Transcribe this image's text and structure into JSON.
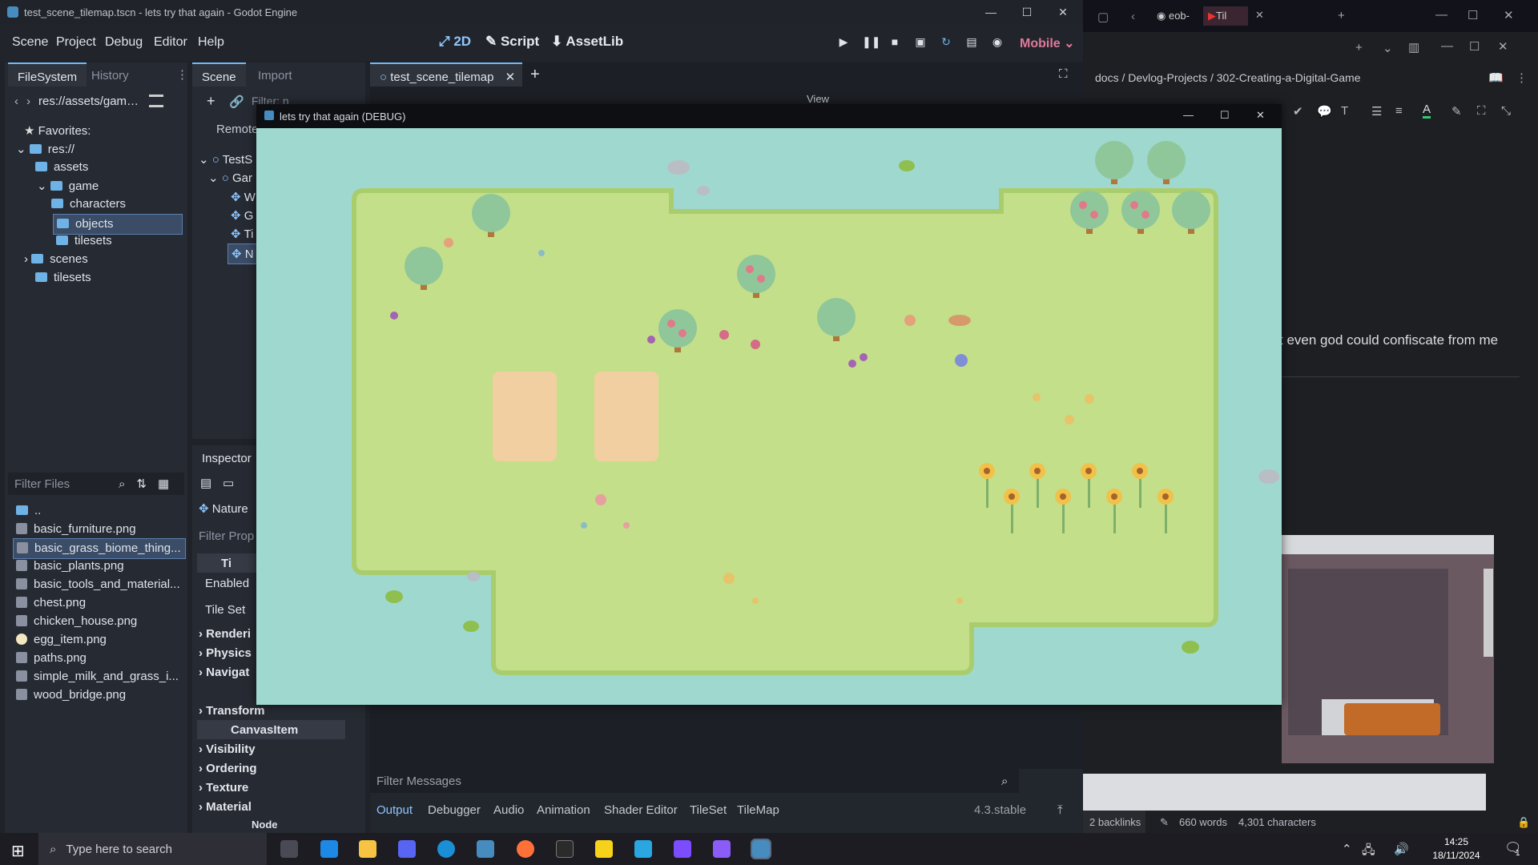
{
  "godot": {
    "window_title": "test_scene_tilemap.tscn - lets try that again - Godot Engine",
    "menu": [
      "Scene",
      "Project",
      "Debug",
      "Editor",
      "Help"
    ],
    "workspaces": [
      "2D",
      "Script",
      "AssetLib"
    ],
    "renderer": "Mobile",
    "filesystem": {
      "tabs": [
        "FileSystem",
        "History"
      ],
      "path": "res://assets/game/o",
      "favorites_label": "Favorites:",
      "tree": [
        "res://",
        "assets",
        "game",
        "characters",
        "objects",
        "tilesets",
        "scenes",
        "tilesets"
      ],
      "filter_placeholder": "Filter Files",
      "files": [
        "..",
        "basic_furniture.png",
        "basic_grass_biome_thing...",
        "basic_plants.png",
        "basic_tools_and_material...",
        "chest.png",
        "chicken_house.png",
        "egg_item.png",
        "paths.png",
        "simple_milk_and_grass_i...",
        "wood_bridge.png"
      ]
    },
    "scene_dock": {
      "tabs": [
        "Scene",
        "Import"
      ],
      "filter_placeholder": "Filter: n",
      "remote_label": "Remote",
      "nodes": [
        "TestS",
        "Gar",
        "W",
        "G",
        "Ti",
        "N"
      ]
    },
    "inspector": {
      "title": "Inspector",
      "node_name": "Nature",
      "filter_placeholder": "Filter Prop",
      "tile_label": "Ti",
      "rows": [
        "Enabled",
        "Tile Set"
      ],
      "sections": [
        "Renderi",
        "Physics",
        "Navigat",
        "Transform",
        "CanvasItem",
        "Visibility",
        "Ordering",
        "Texture",
        "Material"
      ],
      "node_footer": "Node"
    },
    "editor": {
      "tab": "test_scene_tilemap",
      "view_menu": "View",
      "filter_messages_placeholder": "Filter Messages",
      "bottom_tabs": [
        "Output",
        "Debugger",
        "Audio",
        "Animation",
        "Shader Editor",
        "TileSet",
        "TileMap"
      ],
      "version": "4.3.stable"
    }
  },
  "game_window": {
    "title": "lets try that again (DEBUG)"
  },
  "notes_app": {
    "browser_tabs": [
      "eob-",
      "Til"
    ],
    "breadcrumb": [
      "docs",
      "Devlog-Projects",
      "302-Creating-a-Digital-Game"
    ],
    "visible_text": "t even god could confiscate from me",
    "status": {
      "backlinks": "2 backlinks",
      "words": "660 words",
      "characters": "4,301 characters"
    }
  },
  "taskbar": {
    "search_placeholder": "Type here to search",
    "time": "14:25",
    "date": "18/11/2024",
    "notification_count": "1"
  },
  "colors": {
    "grass": "#c3df8a",
    "grass_edge": "#a9cd6c",
    "water": "#9fd8cf",
    "sand": "#f2cfa0",
    "godot_accent": "#478cbf",
    "tab_accent": "#70bafa"
  }
}
